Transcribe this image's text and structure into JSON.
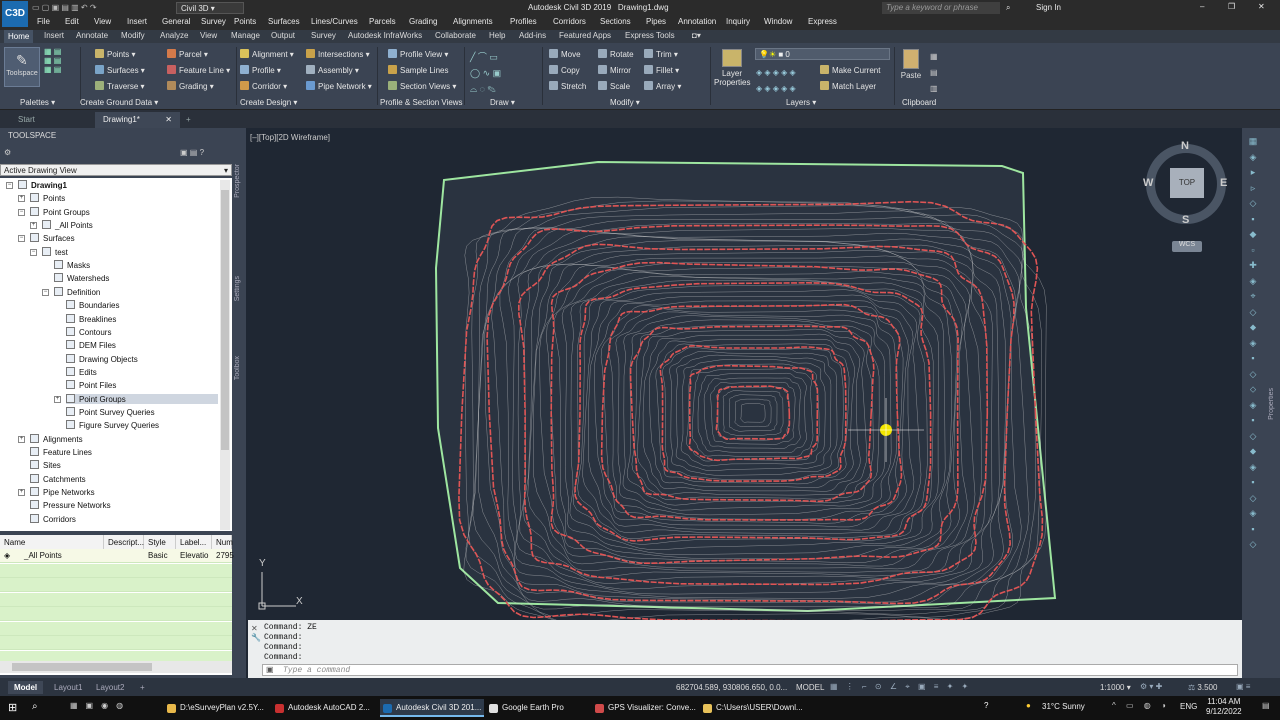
{
  "window": {
    "app_title": "Autodesk Civil 3D 2019",
    "doc_title": "Drawing1.dwg",
    "workspace": "Civil 3D",
    "search_placeholder": "Type a keyword or phrase",
    "sign_in": "Sign In",
    "logo": "C3D"
  },
  "menus": [
    "File",
    "Edit",
    "View",
    "Insert",
    "General",
    "Survey",
    "Points",
    "Surfaces",
    "Lines/Curves",
    "Parcels",
    "Grading",
    "Alignments",
    "Profiles",
    "Corridors",
    "Sections",
    "Pipes",
    "Annotation",
    "Inquiry",
    "Window",
    "Express"
  ],
  "ribbon_tabs": [
    "Home",
    "Insert",
    "Annotate",
    "Modify",
    "Analyze",
    "View",
    "Manage",
    "Output",
    "Survey",
    "Autodesk InfraWorks",
    "Collaborate",
    "Help",
    "Add-ins",
    "Featured Apps",
    "Express Tools"
  ],
  "ribbon": {
    "palettes": {
      "toolspace": "Toolspace",
      "label": "Palettes"
    },
    "ground": {
      "items": [
        "Points",
        "Surfaces",
        "Traverse",
        "Parcel",
        "Feature Line",
        "Grading"
      ],
      "label": "Create Ground Data"
    },
    "design": {
      "items": [
        "Alignment",
        "Profile",
        "Corridor",
        "Intersections",
        "Assembly",
        "Pipe Network"
      ],
      "label": "Create Design"
    },
    "profile": {
      "items": [
        "Profile View",
        "Sample Lines",
        "Section Views"
      ],
      "label": "Profile & Section Views"
    },
    "draw": {
      "label": "Draw"
    },
    "modify": {
      "items": [
        "Move",
        "Copy",
        "Stretch",
        "Rotate",
        "Mirror",
        "Scale",
        "Trim",
        "Fillet",
        "Array"
      ],
      "label": "Modify"
    },
    "layers": {
      "layer_properties": "Layer Properties",
      "layer_value": "0",
      "make_current": "Make Current",
      "match_layer": "Match Layer",
      "label": "Layers"
    },
    "clipboard": {
      "paste": "Paste",
      "label": "Clipboard"
    }
  },
  "doc_tabs": [
    "Start",
    "Drawing1*"
  ],
  "toolspace": {
    "title": "TOOLSPACE",
    "view_select": "Active Drawing View",
    "vtabs": [
      "Prospector",
      "Settings",
      "Toolbox"
    ],
    "tree": [
      "Drawing1",
      "Points",
      "Point Groups",
      "_All Points",
      "Surfaces",
      "test",
      "Masks",
      "Watersheds",
      "Definition",
      "Boundaries",
      "Breaklines",
      "Contours",
      "DEM Files",
      "Drawing Objects",
      "Edits",
      "Point Files",
      "Point Groups",
      "Point Survey Queries",
      "Figure Survey Queries",
      "Alignments",
      "Feature Lines",
      "Sites",
      "Catchments",
      "Pipe Networks",
      "Pressure Networks",
      "Corridors"
    ],
    "grid_headers": [
      "Name",
      "Descript...",
      "Style",
      "Label...",
      "Num"
    ],
    "grid_row": [
      "_All Points",
      "",
      "Basic",
      "Elevatio",
      "2795"
    ]
  },
  "viewport": {
    "label": "[–][Top][2D Wireframe]",
    "compass": {
      "n": "N",
      "s": "S",
      "e": "E",
      "w": "W",
      "top": "TOP",
      "wcs": "WCS"
    },
    "ucs_x": "X",
    "ucs_y": "Y"
  },
  "command": {
    "lines": [
      "Command: ZE",
      "Command:",
      "Command:",
      "Command:"
    ],
    "placeholder": "Type a command"
  },
  "status": {
    "tabs": [
      "Model",
      "Layout1",
      "Layout2"
    ],
    "coords": "682704.589, 930806.650, 0.0...",
    "mode": "MODEL",
    "scale": "1:1000",
    "zoom": "3.500"
  },
  "taskbar": {
    "apps": [
      "D:\\eSurveyPlan v2.5Y...",
      "Autodesk AutoCAD 2...",
      "Autodesk Civil 3D 201...",
      "Google Earth Pro",
      "GPS Visualizer: Conve...",
      "C:\\Users\\USER\\Downl..."
    ],
    "weather": "31°C  Sunny",
    "lang": "ENG",
    "time": "11:04 AM",
    "date": "9/12/2022"
  },
  "colors": {
    "contour_major": "#e05555",
    "contour_minor": "#d8d8d8",
    "boundary": "#9ee6a0",
    "viewport_bg": "#1f2733",
    "cursor_dot": "#f2e600"
  }
}
